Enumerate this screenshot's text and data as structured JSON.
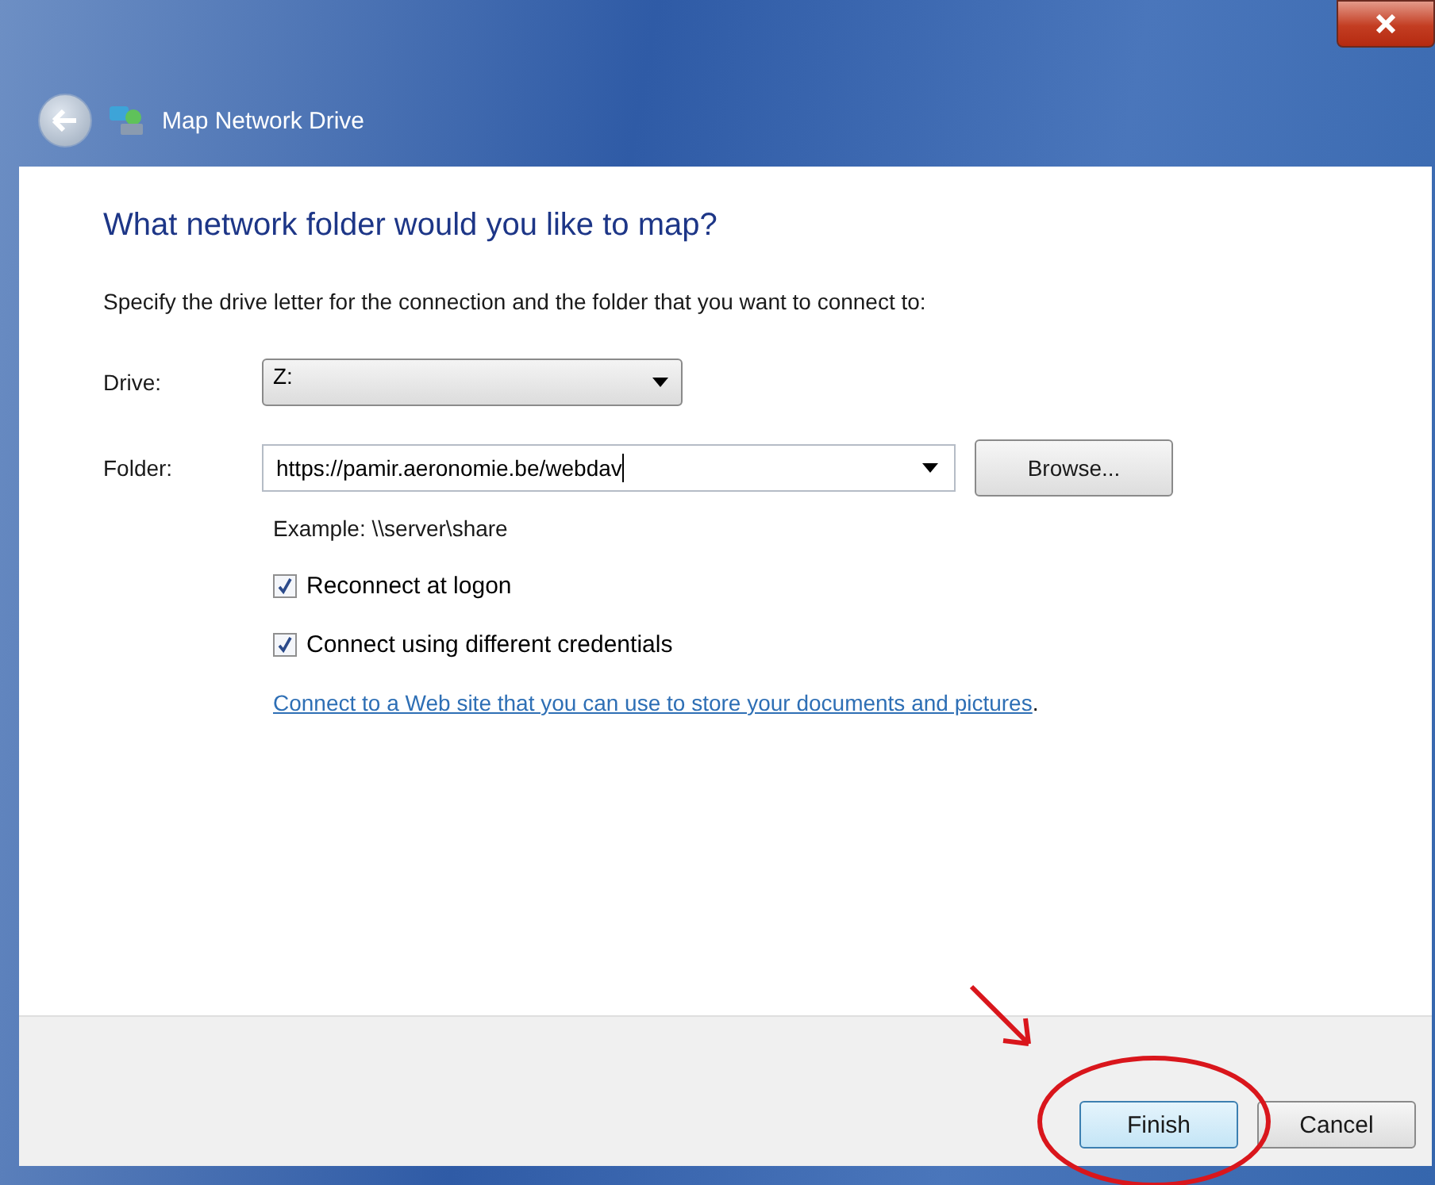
{
  "window": {
    "title": "Map Network Drive"
  },
  "heading": "What network folder would you like to map?",
  "instructions": "Specify the drive letter for the connection and the folder that you want to connect to:",
  "drive": {
    "label": "Drive:",
    "value": "Z:"
  },
  "folder": {
    "label": "Folder:",
    "value": "https://pamir.aeronomie.be/webdav",
    "browse": "Browse..."
  },
  "example": "Example: \\\\server\\share",
  "options": [
    {
      "label": "Reconnect at logon",
      "checked": true
    },
    {
      "label": "Connect using different credentials",
      "checked": true
    }
  ],
  "link": "Connect to a Web site that you can use to store your documents and pictures",
  "link_end": ".",
  "buttons": [
    {
      "label": "Finish",
      "kind": "default"
    },
    {
      "label": "Cancel",
      "kind": "normal"
    }
  ]
}
